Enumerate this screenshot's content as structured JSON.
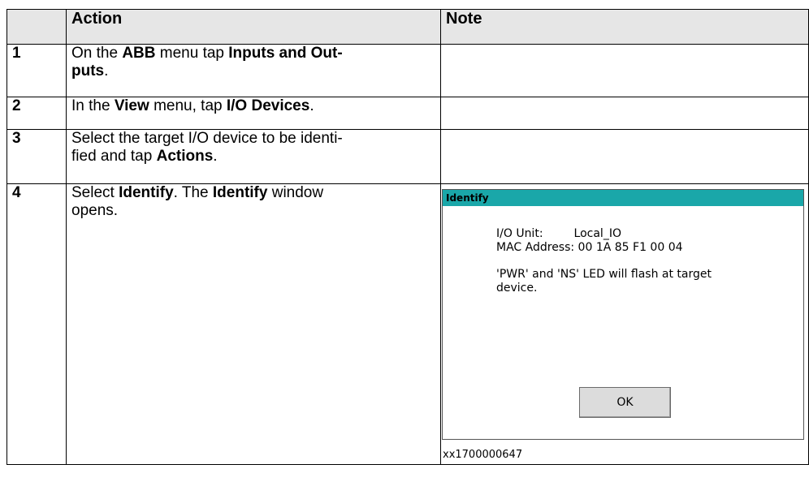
{
  "table": {
    "headers": [
      "",
      "Action",
      "Note"
    ],
    "rows": [
      {
        "num": "1",
        "parts": [
          "On the ",
          "ABB",
          " menu tap ",
          "Inputs and Out-\nputs",
          "."
        ]
      },
      {
        "num": "2",
        "parts": [
          "In the ",
          "View",
          " menu, tap ",
          "I/O Devices",
          "."
        ]
      },
      {
        "num": "3",
        "parts": [
          "Select the target I/O device to be identi-\nfied and tap ",
          "Actions",
          "."
        ]
      },
      {
        "num": "4",
        "parts": [
          "Select ",
          "Identify",
          ". The ",
          "Identify",
          " window\nopens."
        ]
      }
    ]
  },
  "dialog": {
    "title": "Identify",
    "io_unit_label": "I/O Unit:",
    "io_unit_value": "Local_IO",
    "mac_line": "MAC Address: 00 1A 85 F1 00 04",
    "flash_text": "'PWR' and 'NS' LED will flash at target device.",
    "ok_label": "OK"
  },
  "figure_id": "xx1700000647"
}
